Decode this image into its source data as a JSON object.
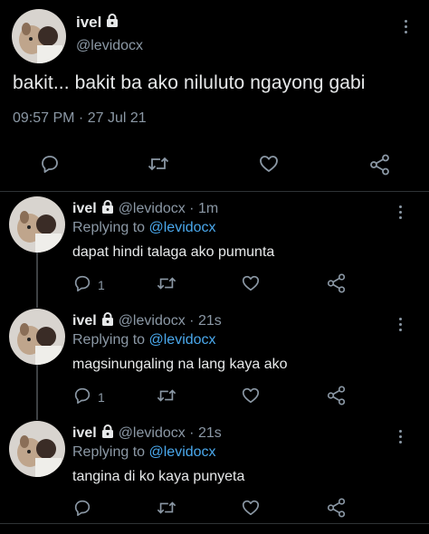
{
  "main_tweet": {
    "display_name": "ivel",
    "handle": "@levidocx",
    "text": "bakit... bakit ba ako niluluto ngayong gabi",
    "timestamp": "09:57 PM · 27 Jul 21",
    "icons": [
      "lock-icon",
      "more-icon",
      "reply-icon",
      "retweet-icon",
      "like-icon",
      "share-icon"
    ]
  },
  "replies": [
    {
      "display_name": "ivel",
      "meta": "@levidocx · 1m",
      "replying_label": "Replying to",
      "replying_to": "@levidocx",
      "text": "dapat hindi talaga ako pumunta",
      "reply_count": "1"
    },
    {
      "display_name": "ivel",
      "meta": "@levidocx · 21s",
      "replying_label": "Replying to",
      "replying_to": "@levidocx",
      "text": "magsinungaling na lang kaya ako",
      "reply_count": "1"
    },
    {
      "display_name": "ivel",
      "meta": "@levidocx · 21s",
      "replying_label": "Replying to",
      "replying_to": "@levidocx",
      "text": "tangina di ko kaya punyeta",
      "reply_count": ""
    }
  ],
  "colors": {
    "background": "#000000",
    "text": "#e7e9ea",
    "muted": "#8b98a5",
    "mention": "#4aa8ec"
  }
}
